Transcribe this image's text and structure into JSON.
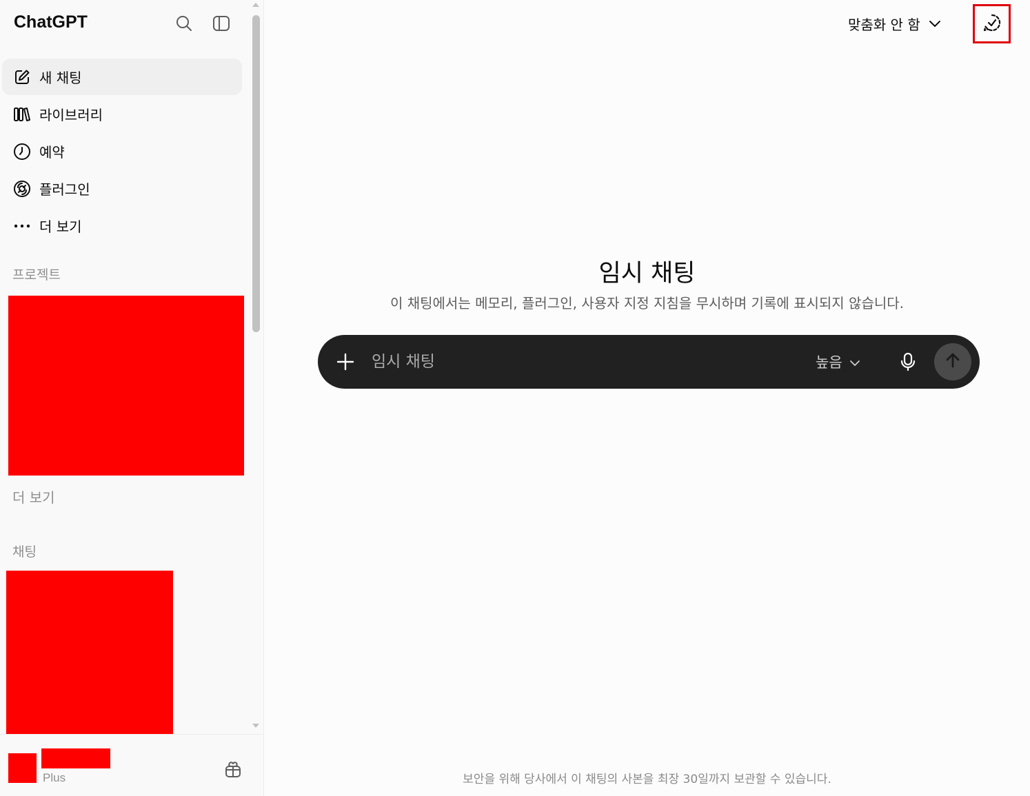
{
  "sidebar": {
    "brand": "ChatGPT",
    "icons": {
      "search": "search-icon",
      "toggle": "sidebar-toggle-icon"
    },
    "nav": [
      {
        "label": "새 채팅",
        "icon": "edit-icon"
      },
      {
        "label": "라이브러리",
        "icon": "library-icon"
      },
      {
        "label": "예약",
        "icon": "clock-icon"
      },
      {
        "label": "플러그인",
        "icon": "plugin-icon"
      },
      {
        "label": "더 보기",
        "icon": "more-dots-icon"
      }
    ],
    "projects_label": "프로젝트",
    "projects_more": "더 보기",
    "chats_label": "채팅",
    "profile": {
      "plan": "Plus"
    }
  },
  "header": {
    "model_label": "맞춤화 안 함",
    "temp_chat_icon": "temporary-chat-icon"
  },
  "main": {
    "title": "임시 채팅",
    "subtitle": "이 채팅에서는 메모리, 플러그인, 사용자 지정 지침을 무시하며 기록에 표시되지 않습니다."
  },
  "composer": {
    "placeholder": "임시 채팅",
    "effort_label": "높음"
  },
  "footer": {
    "note": "보안을 위해 당사에서 이 채팅의 사본을 최장 30일까지 보관할 수 있습니다."
  },
  "colors": {
    "accent_highlight": "#e0000c",
    "composer_bg": "#212121",
    "redaction": "#ff0000"
  }
}
